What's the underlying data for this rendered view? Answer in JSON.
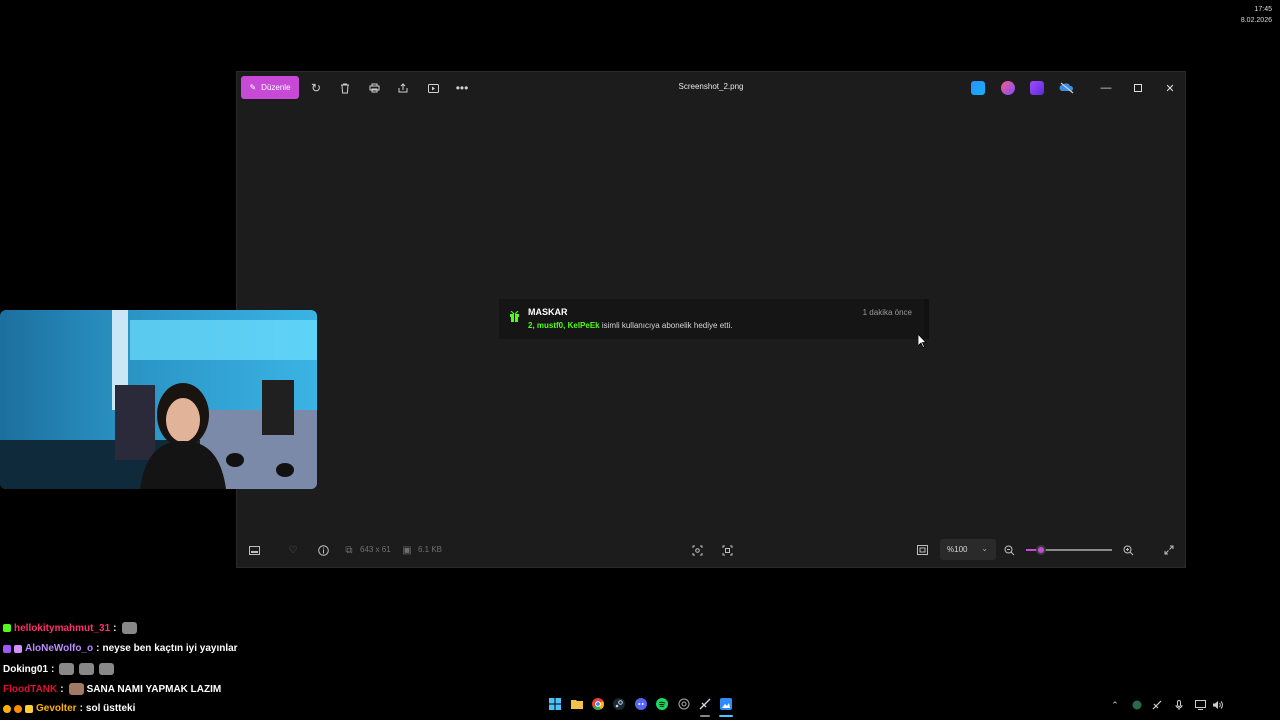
{
  "photos": {
    "edit_label": "Düzenle",
    "file_name": "Screenshot_2.png",
    "image_dimensions": "643 x 61",
    "file_size": "6.1 KB",
    "zoom_value": "%100",
    "zoom_slider_fraction": 0.18
  },
  "notification": {
    "username": "MASKAR",
    "time": "1 dakika önce",
    "gift_count": "2,",
    "recipient_1": "mustf0,",
    "recipient_2": "KelPeEk",
    "message": "isimli kullanıcıya abonelik hediye etti."
  },
  "chat": [
    {
      "user": "hellokitymahmut_31",
      "sep": ":",
      "text": "",
      "color": "#ff2f6d"
    },
    {
      "user": "AloNeWolfo_o",
      "sep": ":",
      "text": "neyse ben kaçtın iyi yayınlar",
      "color": "#b98cff"
    },
    {
      "user": "Doking01",
      "sep": ":",
      "text": "",
      "color": "#ffffff"
    },
    {
      "user": "FloodTANK",
      "sep": ":",
      "text": "SANA NAMI YAPMAK LAZIM",
      "color": "#e0102f"
    },
    {
      "user": "Gevolter",
      "sep": ":",
      "text": "sol üstteki",
      "color": "#ffb300"
    }
  ],
  "taskbar": {
    "time": "17:45",
    "date": "8.02.2026"
  },
  "colors": {
    "accent": "#c64ad6",
    "kick_green": "#53fc18"
  }
}
